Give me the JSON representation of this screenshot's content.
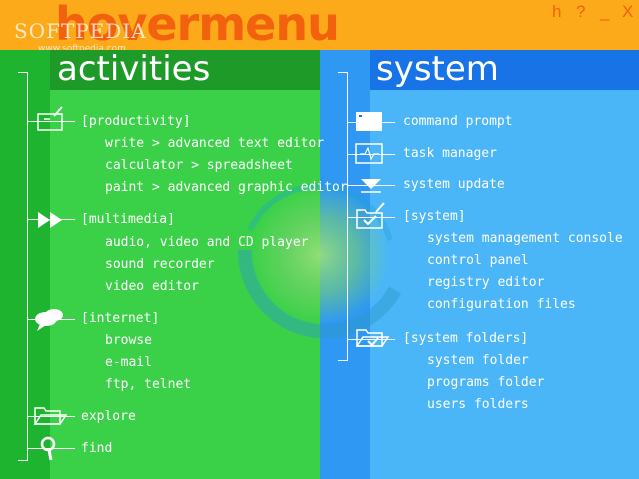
{
  "header": {
    "app_title": "hovermenu",
    "watermark": "SOFTPEDIA",
    "watermark_url": "www.softpedia.com",
    "controls": {
      "help": "h",
      "about": "?",
      "minimize": "_",
      "close": "X"
    }
  },
  "colors": {
    "header_bg": "#FDAA1A",
    "title": "#F2620E",
    "left_bg": "#3AD148",
    "right_bg": "#4AB6F8"
  },
  "left": {
    "title": "activities",
    "groups": [
      {
        "icon": "notepad-icon",
        "label": "[productivity]",
        "items": [
          "write > advanced text editor",
          "calculator > spreadsheet",
          "paint > advanced graphic editor"
        ]
      },
      {
        "icon": "fast-forward-icon",
        "label": "[multimedia]",
        "items": [
          "audio, video and CD player",
          "sound recorder",
          "video editor"
        ]
      },
      {
        "icon": "chat-bubbles-icon",
        "label": "[internet]",
        "items": [
          "browse",
          "e-mail",
          "ftp, telnet"
        ]
      }
    ],
    "singles": [
      {
        "icon": "folder-open-icon",
        "label": "explore"
      },
      {
        "icon": "magnifier-icon",
        "label": "find"
      }
    ]
  },
  "right": {
    "title": "system",
    "singles": [
      {
        "icon": "terminal-icon",
        "label": "command prompt"
      },
      {
        "icon": "monitor-graph-icon",
        "label": "task manager"
      },
      {
        "icon": "download-arrow-icon",
        "label": "system update"
      }
    ],
    "groups": [
      {
        "icon": "system-folder-icon",
        "label": "[system]",
        "items": [
          "system management console",
          "control panel",
          "registry editor",
          "configuration files"
        ]
      },
      {
        "icon": "folder-check-icon",
        "label": "[system folders]",
        "items": [
          "system folder",
          "programs folder",
          "users folders"
        ]
      }
    ]
  }
}
